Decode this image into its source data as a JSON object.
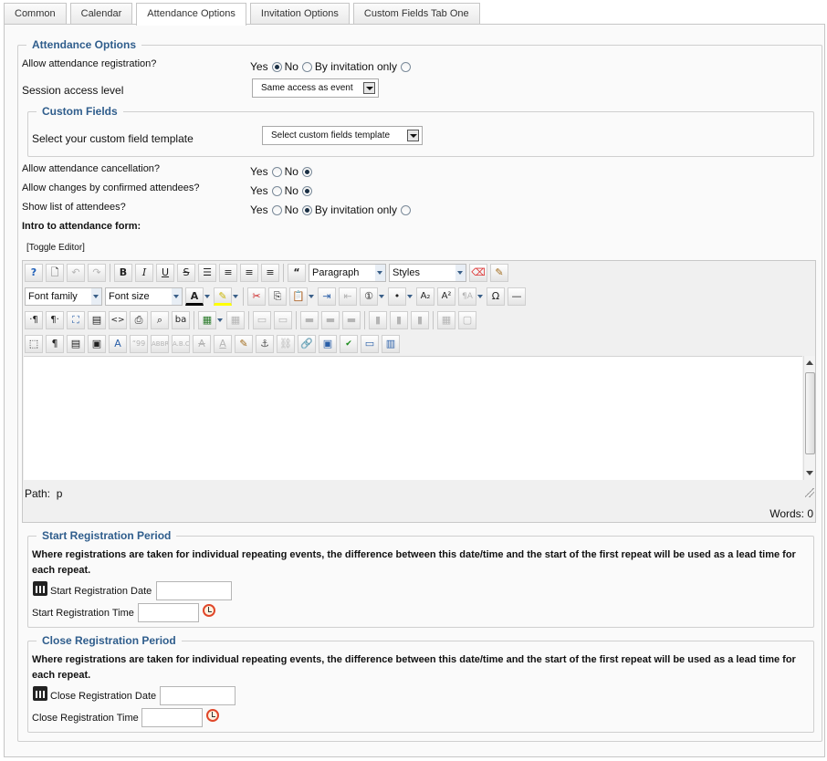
{
  "tabs": [
    {
      "label": "Common",
      "active": false
    },
    {
      "label": "Calendar",
      "active": false
    },
    {
      "label": "Attendance Options",
      "active": true
    },
    {
      "label": "Invitation Options",
      "active": false
    },
    {
      "label": "Custom Fields Tab One",
      "active": false
    }
  ],
  "attendance": {
    "legend": "Attendance Options",
    "allow_registration": {
      "label": "Allow attendance registration?",
      "opt_yes": "Yes",
      "opt_no": "No",
      "opt_invite": "By invitation only",
      "selected": "Yes"
    },
    "session_access": {
      "label": "Session access level",
      "value": "Same access as event"
    },
    "custom_fields": {
      "legend": "Custom Fields",
      "label": "Select your custom field template",
      "value": "Select custom fields template"
    },
    "allow_cancellation": {
      "label": "Allow attendance cancellation?",
      "opt_yes": "Yes",
      "opt_no": "No",
      "selected": "No"
    },
    "allow_changes": {
      "label": "Allow changes by confirmed attendees?",
      "opt_yes": "Yes",
      "opt_no": "No",
      "selected": "No"
    },
    "show_attendees": {
      "label": "Show list of attendees?",
      "opt_yes": "Yes",
      "opt_no": "No",
      "opt_invite": "By invitation only",
      "selected": "No"
    },
    "intro_label": "Intro to attendance form:",
    "toggle_editor": "[Toggle Editor]"
  },
  "editor": {
    "format_select": "Paragraph",
    "styles_select": "Styles",
    "font_family": "Font family",
    "font_size": "Font size",
    "path_label": "Path:",
    "path_value": "p",
    "words": "Words: 0",
    "icons_row1": [
      "help-icon",
      "new-document-icon",
      "undo-icon",
      "redo-icon",
      "bold-icon",
      "italic-icon",
      "underline-icon",
      "strikethrough-icon",
      "justify-full-icon",
      "align-center-icon",
      "align-left-icon",
      "align-right-icon",
      "blockquote-icon",
      "remove-format-icon",
      "cleanup-icon"
    ],
    "icons_row2": [
      "font-color-icon",
      "highlight-icon",
      "cut-icon",
      "copy-icon",
      "paste-icon",
      "indent-icon",
      "outdent-icon",
      "ordered-list-icon",
      "unordered-list-icon",
      "subscript-icon",
      "superscript-icon",
      "char-map-icon",
      "horizontal-rule-icon"
    ]
  },
  "start_period": {
    "legend": "Start Registration Period",
    "note": "Where registrations are taken for individual repeating events, the difference between this date/time and the start of the first repeat will be used as a lead time for each repeat.",
    "date_label": "Start Registration Date",
    "time_label": "Start Registration Time",
    "date_value": "",
    "time_value": ""
  },
  "close_period": {
    "legend": "Close Registration Period",
    "note": "Where registrations are taken for individual repeating events, the difference between this date/time and the start of the first repeat will be used as a lead time for each repeat.",
    "date_label": "Close Registration Date",
    "time_label": "Close Registration Time",
    "date_value": "",
    "time_value": ""
  }
}
